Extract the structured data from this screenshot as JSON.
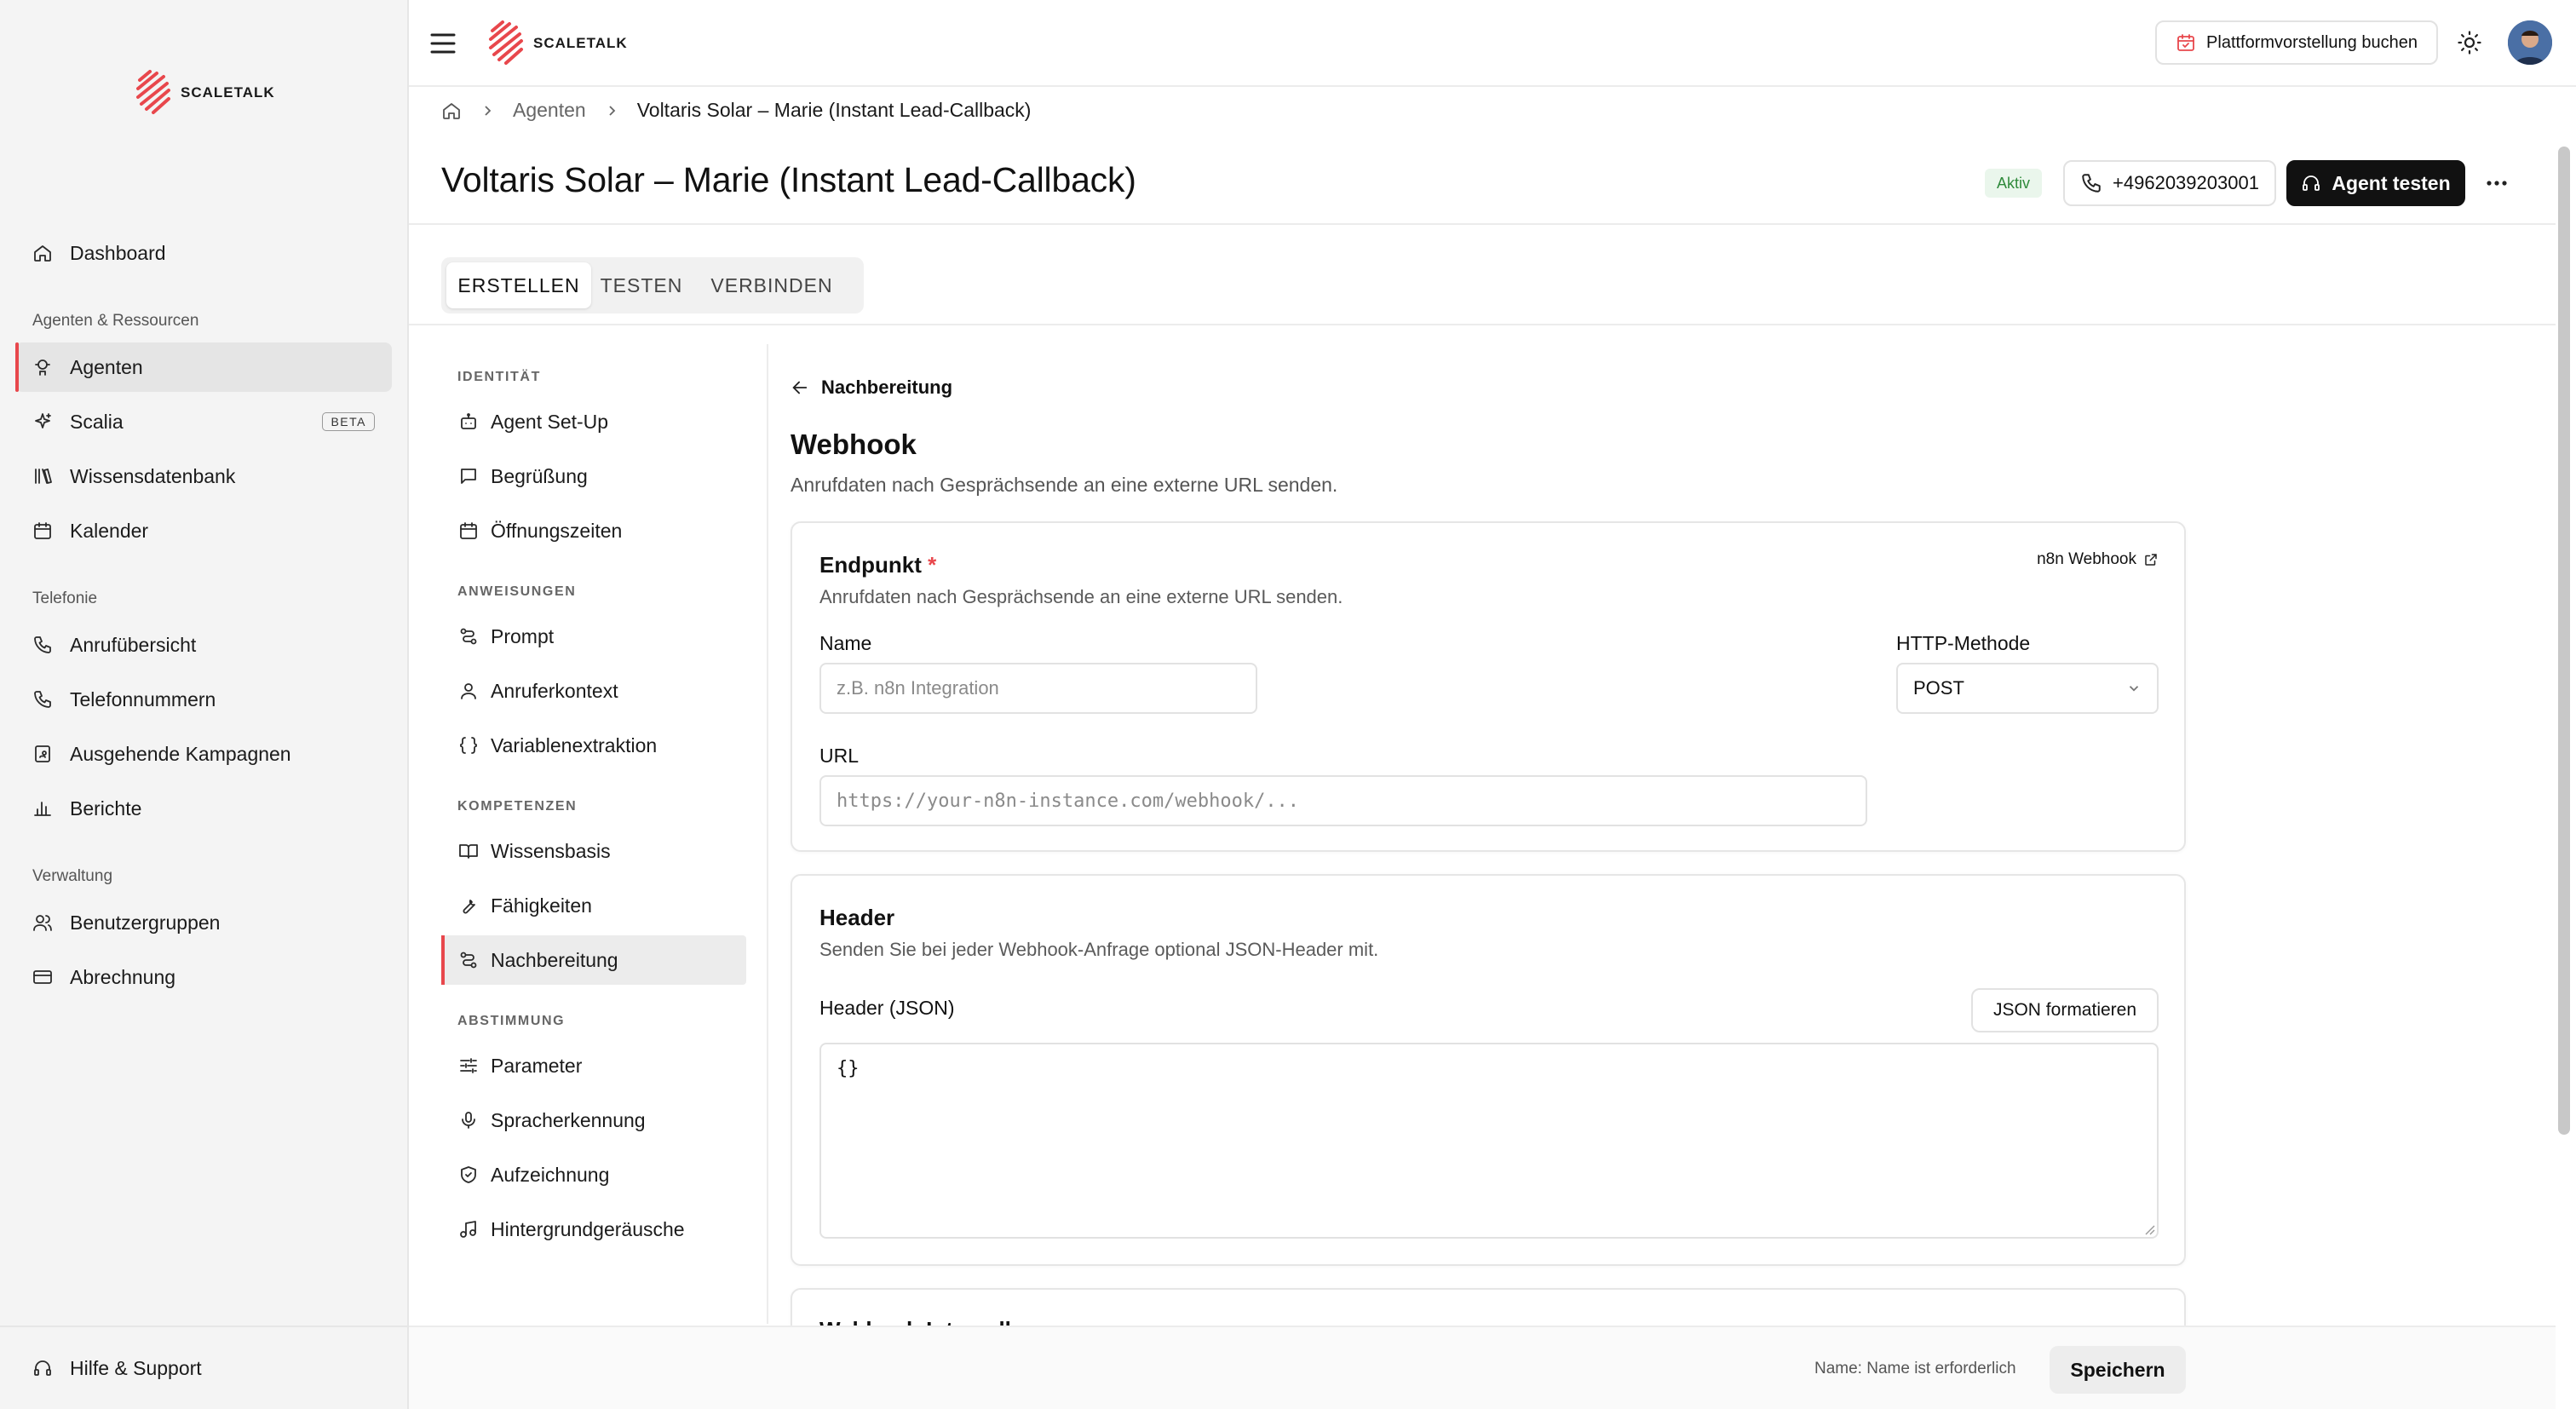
{
  "brand": {
    "name": "SCALETALK"
  },
  "sidebar": {
    "dashboard": "Dashboard",
    "group_agents": "Agenten & Ressourcen",
    "agenten": "Agenten",
    "scalia": "Scalia",
    "scalia_badge": "BETA",
    "wissensdatenbank": "Wissensdatenbank",
    "kalender": "Kalender",
    "group_telefonie": "Telefonie",
    "anrufuebersicht": "Anrufübersicht",
    "telefonnummern": "Telefonnummern",
    "kampagnen": "Ausgehende Kampagnen",
    "berichte": "Berichte",
    "group_verwaltung": "Verwaltung",
    "benutzergruppen": "Benutzergruppen",
    "abrechnung": "Abrechnung",
    "hilfe": "Hilfe & Support"
  },
  "topbar": {
    "book_demo": "Plattformvorstellung buchen"
  },
  "breadcrumb": {
    "level1": "Agenten",
    "current": "Voltaris Solar – Marie (Instant Lead-Callback)"
  },
  "header": {
    "title": "Voltaris Solar – Marie (Instant Lead-Callback)",
    "status": "Aktiv",
    "phone": "+4962039203001",
    "test_button": "Agent testen"
  },
  "tabs": {
    "erstellen": "ERSTELLEN",
    "testen": "TESTEN",
    "verbinden": "VERBINDEN"
  },
  "subnav": {
    "identitaet": "IDENTITÄT",
    "agent_setup": "Agent Set-Up",
    "begruessung": "Begrüßung",
    "oeffnungszeiten": "Öffnungszeiten",
    "anweisungen": "ANWEISUNGEN",
    "prompt": "Prompt",
    "anruferkontext": "Anruferkontext",
    "variablen": "Variablenextraktion",
    "kompetenzen": "KOMPETENZEN",
    "wissensbasis": "Wissensbasis",
    "faehigkeiten": "Fähigkeiten",
    "nachbereitung": "Nachbereitung",
    "abstimmung": "ABSTIMMUNG",
    "parameter": "Parameter",
    "spracherkennung": "Spracherkennung",
    "aufzeichnung": "Aufzeichnung",
    "hintergrund": "Hintergrundgeräusche"
  },
  "content": {
    "back_label": "Nachbereitung",
    "title": "Webhook",
    "description": "Anrufdaten nach Gesprächsende an eine externe URL senden.",
    "endpoint": {
      "title": "Endpunkt",
      "required": "*",
      "description": "Anrufdaten nach Gesprächsende an eine externe URL senden.",
      "doc_link": "n8n Webhook",
      "name_label": "Name",
      "name_placeholder": "z.B. n8n Integration",
      "method_label": "HTTP-Methode",
      "method_value": "POST",
      "url_label": "URL",
      "url_placeholder": "https://your-n8n-instance.com/webhook/..."
    },
    "header": {
      "title": "Header",
      "description": "Senden Sie bei jeder Webhook-Anfrage optional JSON-Header mit.",
      "json_label": "Header (JSON)",
      "format_button": "JSON formatieren",
      "json_value": "{}"
    },
    "next_card_title": "Webhook-Intervall"
  },
  "footer": {
    "validation": "Name: Name ist erforderlich",
    "save": "Speichern"
  },
  "colors": {
    "accent_red": "#e8474c",
    "status_green": "#2f8a3b",
    "status_bg": "#eaf6ec"
  }
}
